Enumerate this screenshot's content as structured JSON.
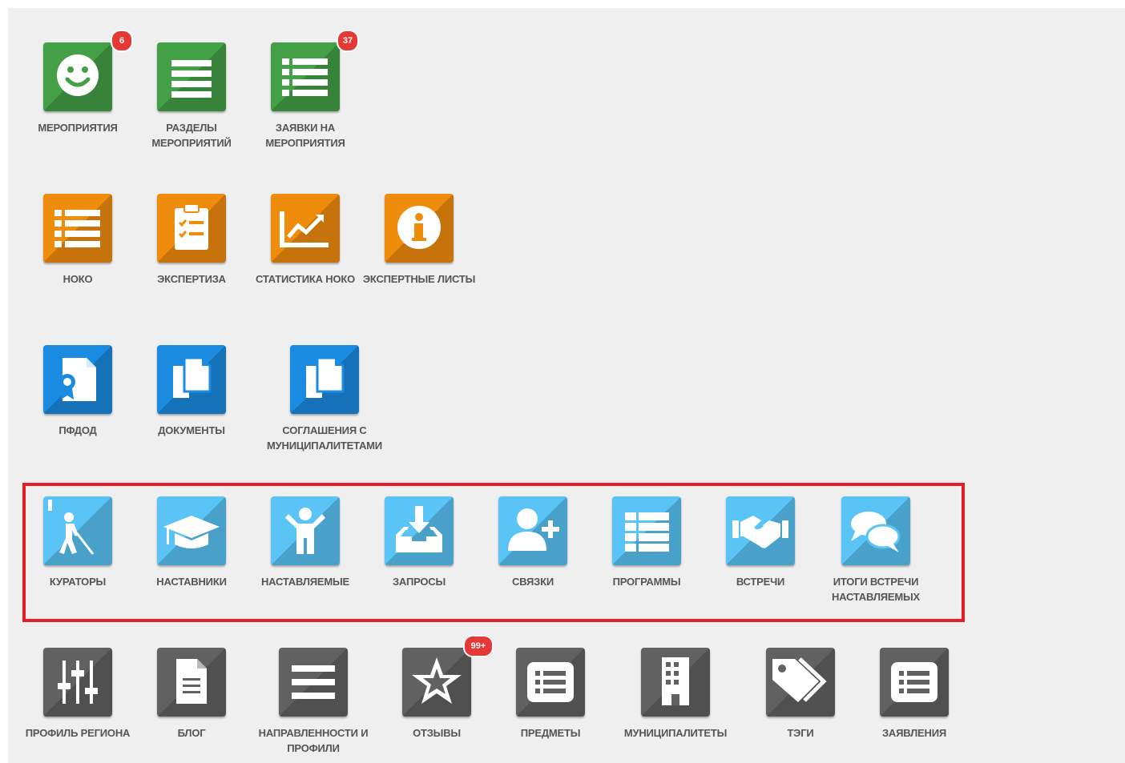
{
  "colors": {
    "background": "#efefef",
    "green": "#43a047",
    "orange": "#f08c0c",
    "blue": "#1a8be0",
    "light_blue": "#59c4f5",
    "dark_gray": "#616161",
    "badge_red": "#e53935",
    "highlight_red": "#e31e24",
    "label": "#555555"
  },
  "rows": {
    "events": [
      {
        "label": "МЕРОПРИЯТИЯ",
        "icon": "smiley-icon",
        "badge": "6"
      },
      {
        "label": "РАЗДЕЛЫ МЕРОПРИЯТИЙ",
        "icon": "lines-icon"
      },
      {
        "label": "ЗАЯВКИ НА МЕРОПРИЯТИЯ",
        "icon": "list-icon",
        "badge": "37"
      }
    ],
    "noko": [
      {
        "label": "НОКО",
        "icon": "list-icon"
      },
      {
        "label": "ЭКСПЕРТИЗА",
        "icon": "clipboard-icon"
      },
      {
        "label": "СТАТИСТИКА НОКО",
        "icon": "line-chart-icon"
      },
      {
        "label": "ЭКСПЕРТНЫЕ ЛИСТЫ",
        "icon": "info-icon"
      }
    ],
    "documents": [
      {
        "label": "ПФДОД",
        "icon": "certificate-icon"
      },
      {
        "label": "ДОКУМЕНТЫ",
        "icon": "copy-icon"
      },
      {
        "label": "СОГЛАШЕНИЯ С МУНИЦИПАЛИТЕТАМИ",
        "icon": "copy-icon"
      }
    ],
    "mentoring": [
      {
        "label": "КУРАТОРЫ",
        "icon": "blind-person-icon"
      },
      {
        "label": "НАСТАВНИКИ",
        "icon": "graduation-cap-icon"
      },
      {
        "label": "НАСТАВЛЯЕМЫЕ",
        "icon": "child-icon"
      },
      {
        "label": "ЗАПРОСЫ",
        "icon": "inbox-download-icon"
      },
      {
        "label": "СВЯЗКИ",
        "icon": "user-plus-icon"
      },
      {
        "label": "ПРОГРАММЫ",
        "icon": "table-list-icon"
      },
      {
        "label": "ВСТРЕЧИ",
        "icon": "handshake-icon"
      },
      {
        "label": "ИТОГИ ВСТРЕЧИ НАСТАВЛЯЕМЫХ",
        "icon": "chat-bubbles-icon"
      }
    ],
    "settings": [
      {
        "label": "ПРОФИЛЬ РЕГИОНА",
        "icon": "sliders-icon"
      },
      {
        "label": "БЛОГ",
        "icon": "file-text-icon"
      },
      {
        "label": "НАПРАВЛЕННОСТИ И ПРОФИЛИ",
        "icon": "lines-icon"
      },
      {
        "label": "ОТЗЫВЫ",
        "icon": "star-icon",
        "badge": "99+"
      },
      {
        "label": "ПРЕДМЕТЫ",
        "icon": "list-box-icon"
      },
      {
        "label": "МУНИЦИПАЛИТЕТЫ",
        "icon": "building-icon"
      },
      {
        "label": "ТЭГИ",
        "icon": "tags-icon"
      },
      {
        "label": "ЗАЯВЛЕНИЯ",
        "icon": "list-box-icon"
      }
    ]
  }
}
